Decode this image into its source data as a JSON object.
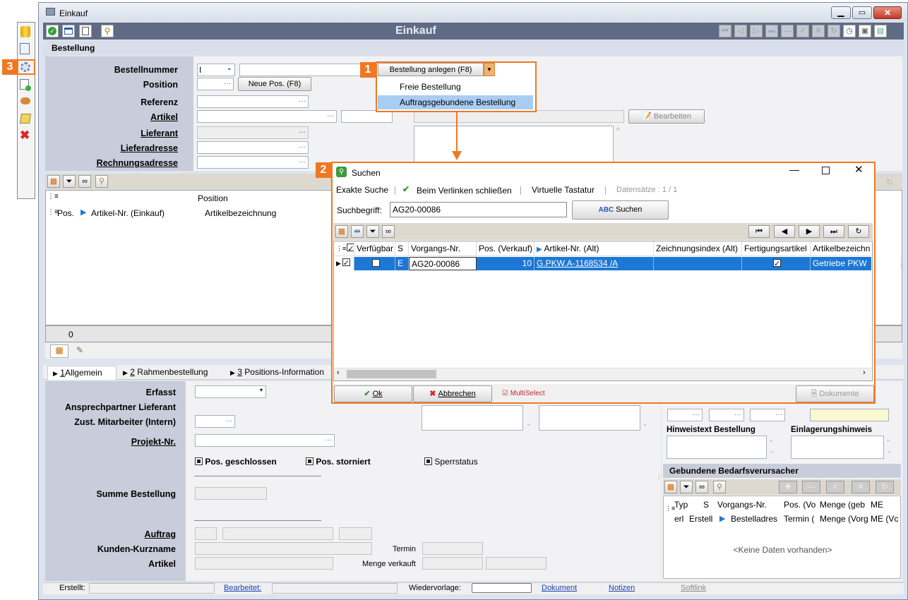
{
  "window": {
    "title": "Einkauf",
    "header_title": "Einkauf",
    "section": "Bestellung"
  },
  "left_toolbar": {
    "badge": "3"
  },
  "form": {
    "bestellnummer_label": "Bestellnummer",
    "bestellnummer_select": "I",
    "position_label": "Position",
    "neue_pos_button": "Neue Pos. (F8)",
    "referenz_label": "Referenz",
    "artikel_label": "Artikel",
    "lieferant_label": "Lieferant",
    "lieferadresse_label": "Lieferadresse",
    "rechnungsadresse_label": "Rechnungsadresse",
    "bearbeiten_button": "Bearbeiten"
  },
  "create_dropdown": {
    "badge": "1",
    "button_label": "Bestellung anlegen (F8)",
    "items": [
      {
        "label": "Freie Bestellung",
        "selected": false
      },
      {
        "label": "Auftragsgebundene Bestellung",
        "selected": true
      }
    ]
  },
  "position_grid": {
    "headers": {
      "group": "Position",
      "pos": "Pos.",
      "artikel_nr": "Artikel-Nr. (Einkauf)",
      "bezeichnung": "Artikelbezeichnung"
    },
    "footer_count": "0"
  },
  "tabs": [
    {
      "number": "1",
      "label": "Allgemein"
    },
    {
      "number": "2",
      "label": "Rahmenbestellung"
    },
    {
      "number": "3",
      "label": "Positions-Information"
    }
  ],
  "general": {
    "erfasst_label": "Erfasst",
    "ansprechpartner_label": "Ansprechpartner Lieferant",
    "zust_mitarbeiter_label": "Zust. Mitarbeiter (Intern)",
    "projekt_label": "Projekt-Nr.",
    "pos_geschlossen": "Pos. geschlossen",
    "pos_storniert": "Pos. storniert",
    "sperrstatus": "Sperrstatus",
    "summe_label": "Summe Bestellung",
    "auftrag_label": "Auftrag",
    "kunden_kurzname_label": "Kunden-Kurzname",
    "artikel_label": "Artikel",
    "termin_label": "Termin",
    "menge_verkauft_label": "Menge verkauft"
  },
  "right_panel": {
    "hinweistext_label": "Hinweistext Bestellung",
    "einlagerungshinweis_label": "Einlagerungshinweis",
    "gebundene_title": "Gebundene Bedarfsverursacher",
    "headers_row1": [
      "Typ",
      "S",
      "Vorgangs-Nr.",
      "Pos. (Vo",
      "Menge (geb",
      "ME"
    ],
    "headers_row2": [
      "erl",
      "Erstell",
      "Bestelladres",
      "Termin (",
      "Menge (Vorg",
      "ME (Vc"
    ],
    "empty_text": "<Keine Daten vorhanden>"
  },
  "search_dialog": {
    "badge": "2",
    "title": "Suchen",
    "exakte_suche": "Exakte Suche",
    "beim_verlinken": "Beim Verlinken schließen",
    "virtuelle_tastatur": "Virtuelle Tastatur",
    "datensaetze": "Datensätze : 1 / 1",
    "suchbegriff_label": "Suchbegriff:",
    "suchbegriff_value": "AG20-00086",
    "suchen_button": "Suchen",
    "columns": [
      "Verfügbar",
      "S",
      "Vorgangs-Nr.",
      "Pos. (Verkauf)",
      "Artikel-Nr. (Alt)",
      "Zeichnungsindex (Alt)",
      "Fertigungsartikel",
      "Artikelbezeichn"
    ],
    "row": {
      "s": "E",
      "vorgangs_nr": "AG20-00086",
      "pos": "10",
      "artikel_nr": "G.PKW.A-1168534 /A",
      "zeichnungsindex": "",
      "bezeichnung": "Getriebe PKW"
    },
    "ok_button": "Ok",
    "abbrechen_button": "Abbrechen",
    "multiselect": "MultiSelect",
    "dokumente_button": "Dokumente"
  },
  "status_bar": {
    "erstellt": "Erstellt:",
    "bearbeitet": "Bearbeitet:",
    "wiedervorlage": "Wiedervorlage:",
    "dokument": "Dokument",
    "notizen": "Notizen",
    "softlink": "Softlink"
  },
  "colors": {
    "accent": "#f07822",
    "header": "#5f6b84",
    "selection": "#1c78d4",
    "form_bg": "#c9cddb"
  }
}
